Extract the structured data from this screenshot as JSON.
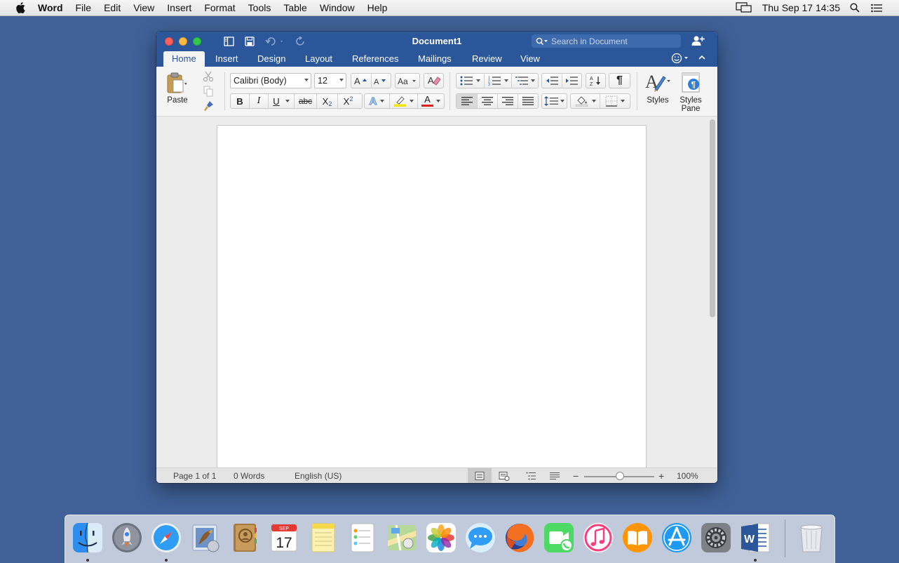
{
  "menubar": {
    "app_name": "Word",
    "items": [
      "File",
      "Edit",
      "View",
      "Insert",
      "Format",
      "Tools",
      "Table",
      "Window",
      "Help"
    ],
    "clock": "Thu Sep 17  14:35"
  },
  "window": {
    "title": "Document1",
    "search_placeholder": "Search in Document",
    "tabs": [
      "Home",
      "Insert",
      "Design",
      "Layout",
      "References",
      "Mailings",
      "Review",
      "View"
    ],
    "active_tab": "Home"
  },
  "ribbon": {
    "paste_label": "Paste",
    "font_name": "Calibri (Body)",
    "font_size": "12",
    "bold": "B",
    "italic": "I",
    "underline": "U",
    "strikethrough": "abc",
    "subscript": "X",
    "subscript_mark": "2",
    "superscript": "X",
    "superscript_mark": "2",
    "text_effects": "A",
    "font_color_letter": "A",
    "font_color": "#e02020",
    "highlight_color": "#f5e300",
    "pilcrow": "¶",
    "styles_label": "Styles",
    "styles_pane_label_1": "Styles",
    "styles_pane_label_2": "Pane"
  },
  "status": {
    "page": "Page 1 of 1",
    "words": "0 Words",
    "language": "English (US)",
    "zoom": "100%",
    "zoom_minus": "−",
    "zoom_plus": "+"
  },
  "colors": {
    "desktop": "#3f6198",
    "word_blue": "#2b579a"
  },
  "dock": {
    "apps": [
      "finder-icon",
      "launchpad-icon",
      "safari-icon",
      "mail-icon",
      "contacts-icon",
      "calendar-icon",
      "notes-icon",
      "reminders-icon",
      "maps-icon",
      "photos-icon",
      "messages-icon",
      "firefox-icon",
      "facetime-icon",
      "itunes-icon",
      "ibooks-icon",
      "app-store-icon",
      "system-preferences-icon",
      "word-icon",
      "trash-icon"
    ],
    "calendar_month": "SEP",
    "calendar_day": "17"
  }
}
